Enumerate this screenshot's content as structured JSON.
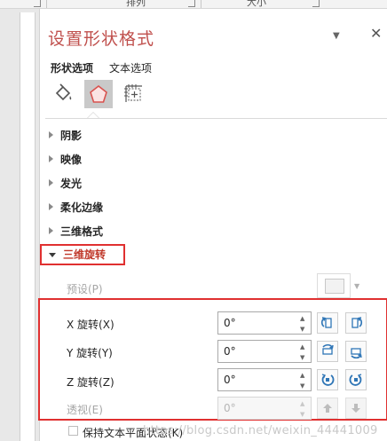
{
  "ribbon": {
    "arrange_label": "排列",
    "size_label": "大小"
  },
  "pane": {
    "title": "设置形状格式",
    "dropdown_glyph": "▼",
    "close_glyph": "✕",
    "tabs": [
      {
        "label": "形状选项",
        "active": true
      },
      {
        "label": "文本选项",
        "active": false
      }
    ],
    "icons": [
      "fill-line-icon",
      "effects-pentagon-icon",
      "size-properties-icon"
    ]
  },
  "sections": [
    {
      "label": "阴影",
      "expanded": false
    },
    {
      "label": "映像",
      "expanded": false
    },
    {
      "label": "发光",
      "expanded": false
    },
    {
      "label": "柔化边缘",
      "expanded": false
    },
    {
      "label": "三维格式",
      "expanded": false
    },
    {
      "label": "三维旋转",
      "expanded": true
    }
  ],
  "rotation": {
    "preset_label": "预设(P)",
    "x_label": "X 旋转(X)",
    "x_value": "0°",
    "y_label": "Y 旋转(Y)",
    "y_value": "0°",
    "z_label": "Z 旋转(Z)",
    "z_value": "0°",
    "perspective_label": "透视(E)",
    "perspective_value": "0°",
    "keep_text_flat_label": "保持文本平面状态(K)"
  },
  "watermark": "https://blog.csdn.net/weixin_44441009",
  "colors": {
    "title": "#c0504d",
    "highlight_box": "#e03030",
    "icon_blue": "#2e75b6"
  }
}
